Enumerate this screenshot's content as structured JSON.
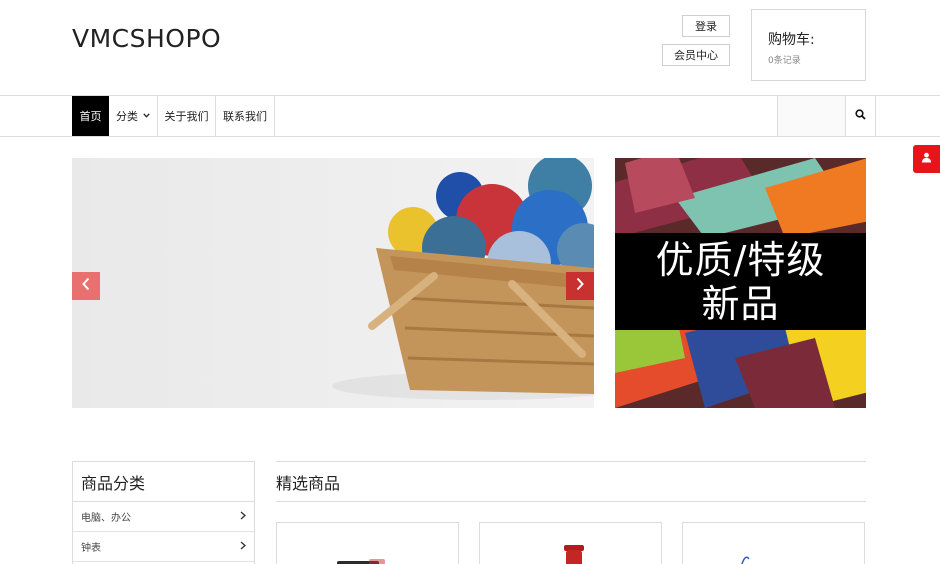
{
  "header": {
    "logo": "VMCSHOPO",
    "login_label": "登录",
    "member_center_label": "会员中心",
    "cart": {
      "title": "购物车:",
      "count_text": "0条记录"
    }
  },
  "nav": {
    "items": [
      {
        "label": "首页"
      },
      {
        "label": "分类"
      },
      {
        "label": "关于我们"
      },
      {
        "label": "联系我们"
      }
    ],
    "search": {
      "value": "",
      "placeholder": ""
    }
  },
  "promo": {
    "line1": "优质/特级",
    "line2": "新品"
  },
  "categories": {
    "title": "商品分类",
    "items": [
      {
        "label": "电脑、办公"
      },
      {
        "label": "钟表"
      }
    ]
  },
  "featured": {
    "title": "精选商品"
  },
  "colors": {
    "accent_red": "#e8141b",
    "nav_active": "#000000",
    "slider_arrow_left": "#e8706f",
    "slider_arrow_right": "#c8312f"
  }
}
